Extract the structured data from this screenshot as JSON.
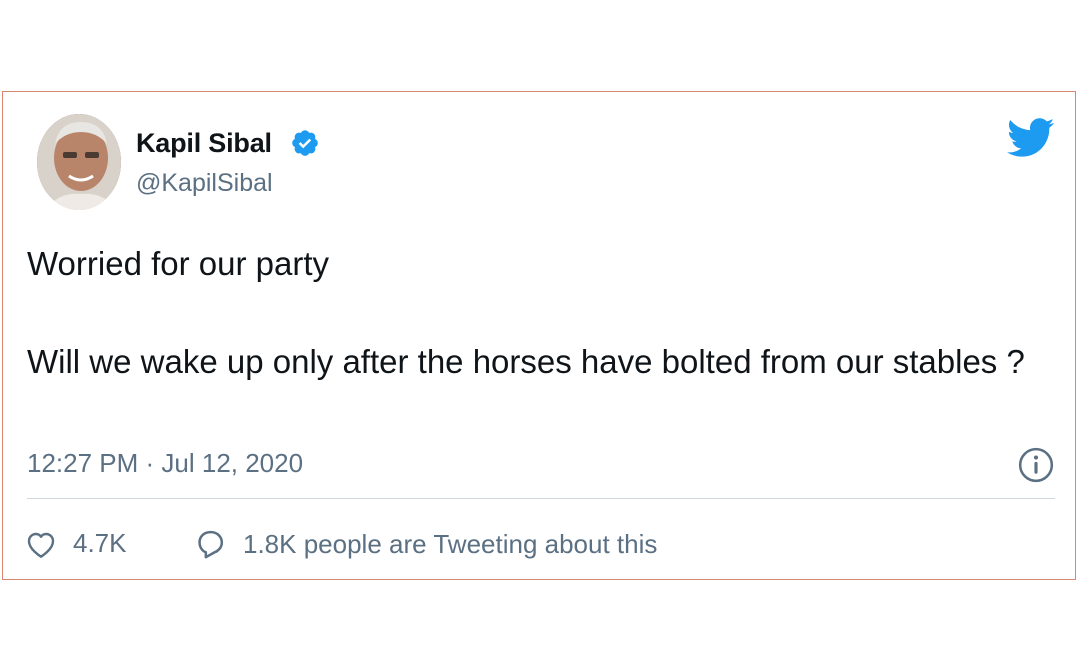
{
  "tweet": {
    "author": {
      "display_name": "Kapil Sibal",
      "handle": "@KapilSibal",
      "verified": true
    },
    "paragraphs": [
      "Worried for our party",
      "Will we wake up only after the horses  have bolted from our stables ?"
    ],
    "timestamp": "12:27 PM · Jul 12, 2020",
    "likes": "4.7K",
    "conversation": "1.8K people are Tweeting about this"
  },
  "colors": {
    "brand": "#1d9bf0",
    "text": "#0f1419",
    "secondary": "#5b7083",
    "card_border": "#d9866f"
  },
  "icons": [
    "verified-icon",
    "twitter-bird-icon",
    "info-icon",
    "heart-icon",
    "reply-bubble-icon"
  ]
}
